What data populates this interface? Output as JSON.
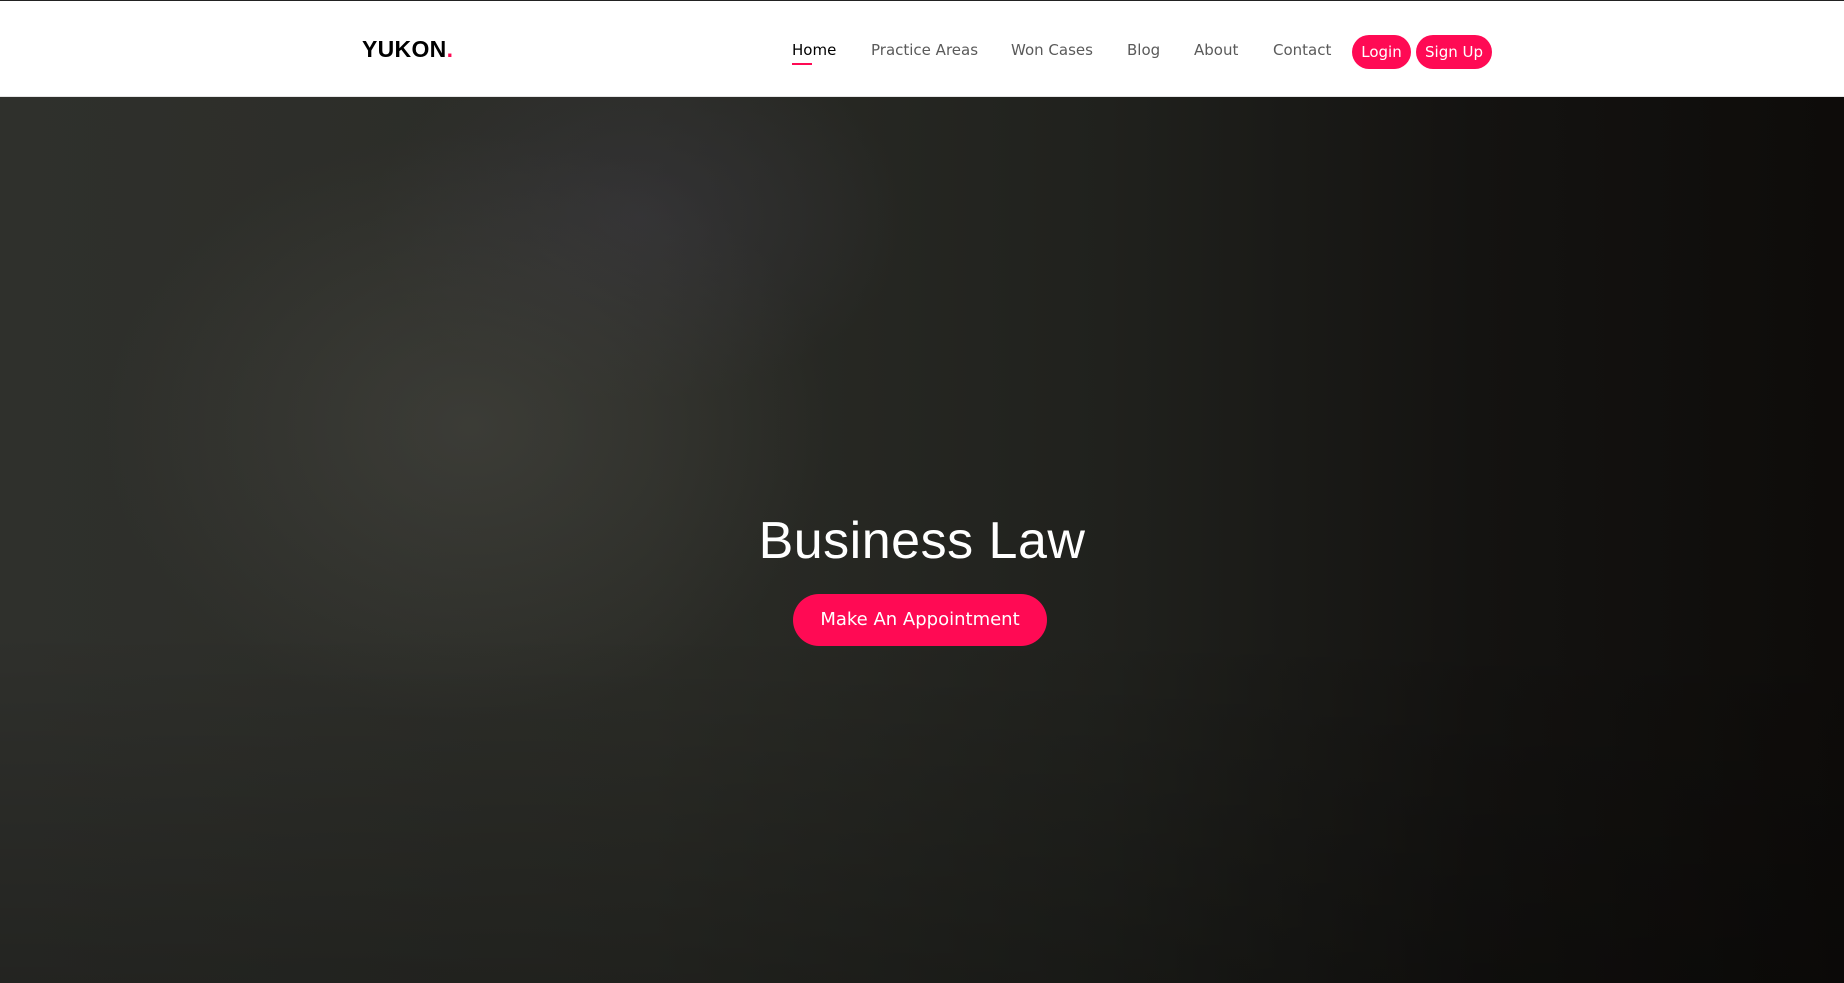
{
  "brand": {
    "logo_text": "YUKON",
    "logo_dot": ".",
    "accent_color": "#ff0a54"
  },
  "nav": {
    "items": [
      {
        "label": "Home",
        "active": true
      },
      {
        "label": "Practice Areas",
        "active": false
      },
      {
        "label": "Won Cases",
        "active": false
      },
      {
        "label": "Blog",
        "active": false
      },
      {
        "label": "About",
        "active": false
      },
      {
        "label": "Contact",
        "active": false
      }
    ],
    "login_label": "Login",
    "signup_label": "Sign Up"
  },
  "hero": {
    "title": "Business Law",
    "cta_label": "Make An Appointment"
  }
}
